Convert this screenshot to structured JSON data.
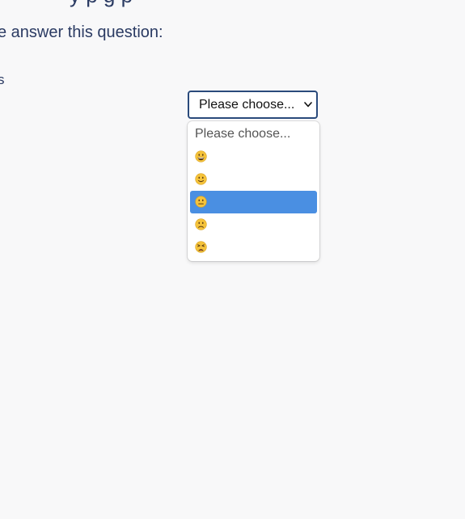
{
  "heading": {
    "text": "y         p            g     p"
  },
  "question": {
    "prompt": "e answer this question:",
    "row_label": "s"
  },
  "select": {
    "value": "Please choose...",
    "chevron_icon": "chevron-down-icon"
  },
  "dropdown": {
    "options": [
      {
        "label": "Please choose...",
        "icon": null
      },
      {
        "label": "",
        "icon": "grinning-face-icon"
      },
      {
        "label": "",
        "icon": "slightly-smiling-face-icon"
      },
      {
        "label": "",
        "icon": "neutral-face-icon",
        "highlighted": true
      },
      {
        "label": "",
        "icon": "slightly-frowning-face-icon"
      },
      {
        "label": "",
        "icon": "tired-face-icon"
      }
    ]
  },
  "colors": {
    "text": "#2b3b63",
    "select_border": "#2a4a7b",
    "highlight": "#4a8fe2",
    "emoji_face": "#f5c33b",
    "background": "#f8f8f9"
  }
}
